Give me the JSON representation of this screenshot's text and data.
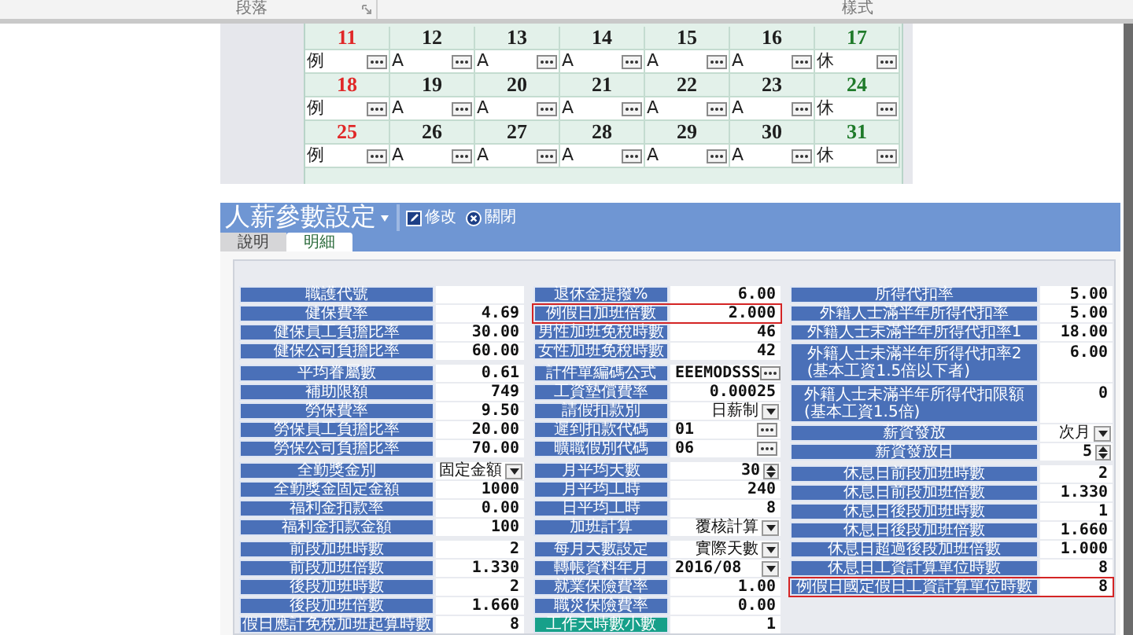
{
  "ribbon": {
    "groups": [
      "段落",
      "樣式"
    ]
  },
  "calendar": {
    "weeks": [
      {
        "days": [
          {
            "date": "11",
            "color": "#e02828",
            "entry": "例"
          },
          {
            "date": "12",
            "color": "#1e1e1e",
            "entry": "A"
          },
          {
            "date": "13",
            "color": "#1e1e1e",
            "entry": "A"
          },
          {
            "date": "14",
            "color": "#1e1e1e",
            "entry": "A"
          },
          {
            "date": "15",
            "color": "#1e1e1e",
            "entry": "A"
          },
          {
            "date": "16",
            "color": "#1e1e1e",
            "entry": "A"
          },
          {
            "date": "17",
            "color": "#1f7a2a",
            "entry": "休"
          }
        ]
      },
      {
        "days": [
          {
            "date": "18",
            "color": "#e02828",
            "entry": "例"
          },
          {
            "date": "19",
            "color": "#1e1e1e",
            "entry": "A"
          },
          {
            "date": "20",
            "color": "#1e1e1e",
            "entry": "A"
          },
          {
            "date": "21",
            "color": "#1e1e1e",
            "entry": "A"
          },
          {
            "date": "22",
            "color": "#1e1e1e",
            "entry": "A"
          },
          {
            "date": "23",
            "color": "#1e1e1e",
            "entry": "A"
          },
          {
            "date": "24",
            "color": "#1f7a2a",
            "entry": "休"
          }
        ]
      },
      {
        "days": [
          {
            "date": "25",
            "color": "#e02828",
            "entry": "例"
          },
          {
            "date": "26",
            "color": "#1e1e1e",
            "entry": "A"
          },
          {
            "date": "27",
            "color": "#1e1e1e",
            "entry": "A"
          },
          {
            "date": "28",
            "color": "#1e1e1e",
            "entry": "A"
          },
          {
            "date": "29",
            "color": "#1e1e1e",
            "entry": "A"
          },
          {
            "date": "30",
            "color": "#1e1e1e",
            "entry": "A"
          },
          {
            "date": "31",
            "color": "#1f7a2a",
            "entry": "休"
          }
        ]
      }
    ]
  },
  "app": {
    "title": "人薪參數設定",
    "toolbar": [
      {
        "label": "修改",
        "kind": "edit"
      },
      {
        "label": "關閉",
        "kind": "close"
      }
    ],
    "tabs": [
      {
        "label": "說明",
        "selected": false
      },
      {
        "label": "明細",
        "selected": true
      }
    ]
  },
  "form": {
    "columns": [
      {
        "groups": [
          {
            "rows": [
              {
                "label": "職護代號",
                "kind": "text",
                "highlighted": false,
                "focused": false
              },
              {
                "label": "健保費率",
                "value": "4.69",
                "kind": "text",
                "highlighted": false,
                "focused": false
              },
              {
                "label": "健保員工負擔比率",
                "value": "30.00",
                "kind": "text",
                "highlighted": false,
                "focused": false
              },
              {
                "label": "健保公司負擔比率",
                "value": "60.00",
                "kind": "text",
                "highlighted": false,
                "focused": false
              }
            ]
          },
          {
            "rows": [
              {
                "label": "平均眷屬數",
                "value": "0.61",
                "kind": "text",
                "highlighted": false,
                "focused": false
              },
              {
                "label": "補助限額",
                "value": "749",
                "kind": "text",
                "highlighted": false,
                "focused": false
              },
              {
                "label": "勞保費率",
                "value": "9.50",
                "kind": "text",
                "highlighted": false,
                "focused": false
              },
              {
                "label": "勞保員工負擔比率",
                "value": "20.00",
                "kind": "text",
                "highlighted": false,
                "focused": false
              },
              {
                "label": "勞保公司負擔比率",
                "value": "70.00",
                "kind": "text",
                "highlighted": false,
                "focused": false
              }
            ]
          },
          {
            "rows": [
              {
                "label": "全勤獎金別",
                "value": "固定金額",
                "kind": "select",
                "highlighted": false,
                "focused": false
              },
              {
                "label": "全勤獎金固定金額",
                "value": "1000",
                "kind": "text",
                "highlighted": false,
                "focused": false
              },
              {
                "label": "福利金扣款率",
                "value": "0.00",
                "kind": "text",
                "highlighted": false,
                "focused": false
              },
              {
                "label": "福利金扣款金額",
                "value": "100",
                "kind": "text",
                "highlighted": false,
                "focused": false
              }
            ]
          },
          {
            "rows": [
              {
                "label": "前段加班時數",
                "value": "2",
                "kind": "text",
                "highlighted": false,
                "focused": false
              },
              {
                "label": "前段加班倍數",
                "value": "1.330",
                "kind": "text",
                "highlighted": false,
                "focused": false
              },
              {
                "label": "後段加班時數",
                "value": "2",
                "kind": "text",
                "highlighted": false,
                "focused": false
              },
              {
                "label": "後段加班倍數",
                "value": "1.660",
                "kind": "text",
                "highlighted": false,
                "focused": false
              },
              {
                "label": "假日應計免稅加班起算時數",
                "value": "8",
                "kind": "text",
                "highlighted": false,
                "focused": false
              }
            ]
          }
        ]
      },
      {
        "groups": [
          {
            "rows": [
              {
                "label": "退休金提撥%",
                "value": "6.00",
                "kind": "text",
                "highlighted": false,
                "focused": false
              },
              {
                "label": "例假日加班倍數",
                "value": "2.000",
                "kind": "text",
                "highlighted": true,
                "focused": false
              },
              {
                "label": "男性加班免稅時數",
                "value": "46",
                "kind": "text",
                "highlighted": false,
                "focused": false
              },
              {
                "label": "女性加班免稅時數",
                "value": "42",
                "kind": "text",
                "highlighted": false,
                "focused": false
              }
            ]
          },
          {
            "rows": [
              {
                "label": "計件單編碼公式",
                "value": "EEEMODSSS",
                "kind": "lookup",
                "highlighted": false,
                "focused": false
              },
              {
                "label": "工資墊償費率",
                "value": "0.00025",
                "kind": "text",
                "highlighted": false,
                "focused": false
              },
              {
                "label": "請假扣款別",
                "value": "日薪制",
                "kind": "select",
                "highlighted": false,
                "focused": false
              },
              {
                "label": "遲到扣款代碼",
                "value": "01",
                "kind": "lookup",
                "highlighted": false,
                "focused": false
              },
              {
                "label": "曠職假別代碼",
                "value": "06",
                "kind": "lookup",
                "highlighted": false,
                "focused": false
              }
            ]
          },
          {
            "rows": [
              {
                "label": "月平均天數",
                "value": "30",
                "kind": "spin",
                "highlighted": false,
                "focused": false
              },
              {
                "label": "月平均工時",
                "value": "240",
                "kind": "text",
                "highlighted": false,
                "focused": false
              },
              {
                "label": "日平均工時",
                "value": "8",
                "kind": "text",
                "highlighted": false,
                "focused": false
              },
              {
                "label": "加班計算",
                "value": "覆核計算",
                "kind": "select",
                "highlighted": false,
                "focused": false
              }
            ]
          },
          {
            "rows": [
              {
                "label": "每月天數設定",
                "value": "實際天數",
                "kind": "select",
                "highlighted": false,
                "focused": false
              },
              {
                "label": "轉帳資料年月",
                "value": "2016/08",
                "kind": "period",
                "highlighted": false,
                "focused": false
              },
              {
                "label": "就業保險費率",
                "value": "1.00",
                "kind": "text",
                "highlighted": false,
                "focused": false
              },
              {
                "label": "職災保險費率",
                "value": "0.00",
                "kind": "text",
                "highlighted": false,
                "focused": false
              },
              {
                "label": "工作天時數小數",
                "value": "1",
                "kind": "text",
                "highlighted": false,
                "focused": true
              }
            ]
          }
        ]
      },
      {
        "groups": [
          {
            "rows": [
              {
                "label": "所得代扣率",
                "value": "5.00",
                "kind": "text",
                "highlighted": false,
                "focused": false
              },
              {
                "label": "外籍人士滿半年所得代扣率",
                "value": "5.00",
                "kind": "text",
                "highlighted": false,
                "focused": false
              },
              {
                "label": "外籍人士未滿半年所得代扣率1",
                "value": "18.00",
                "kind": "text",
                "highlighted": false,
                "focused": false
              },
              {
                "label": "外籍人士未滿半年所得代扣率2",
                "note": "(基本工資1.5倍以下者)",
                "value": "6.00",
                "kind": "text",
                "highlighted": false,
                "focused": false
              },
              {
                "label": "外籍人士未滿半年所得代扣限額",
                "note": "(基本工資1.5倍)",
                "value": "0",
                "kind": "text",
                "highlighted": false,
                "focused": false
              },
              {
                "label": "薪資發放",
                "value": "次月",
                "kind": "select",
                "highlighted": false,
                "focused": false
              },
              {
                "label": "薪資發放日",
                "value": "5",
                "kind": "spin",
                "highlighted": false,
                "focused": false
              }
            ]
          },
          {
            "rows": [
              {
                "label": "休息日前段加班時數",
                "value": "2",
                "kind": "text",
                "highlighted": false,
                "focused": false
              },
              {
                "label": "休息日前段加班倍數",
                "value": "1.330",
                "kind": "text",
                "highlighted": false,
                "focused": false
              },
              {
                "label": "休息日後段加班時數",
                "value": "1",
                "kind": "text",
                "highlighted": false,
                "focused": false
              },
              {
                "label": "休息日後段加班倍數",
                "value": "1.660",
                "kind": "text",
                "highlighted": false,
                "focused": false
              },
              {
                "label": "休息日超過後段加班倍數",
                "value": "1.000",
                "kind": "text",
                "highlighted": false,
                "focused": false
              },
              {
                "label": "休息日工資計算單位時數",
                "value": "8",
                "kind": "text",
                "highlighted": false,
                "focused": false
              },
              {
                "label": "例假日國定假日工資計算單位時數",
                "value": "8",
                "kind": "text",
                "highlighted": true,
                "focused": false
              }
            ]
          }
        ]
      }
    ]
  }
}
